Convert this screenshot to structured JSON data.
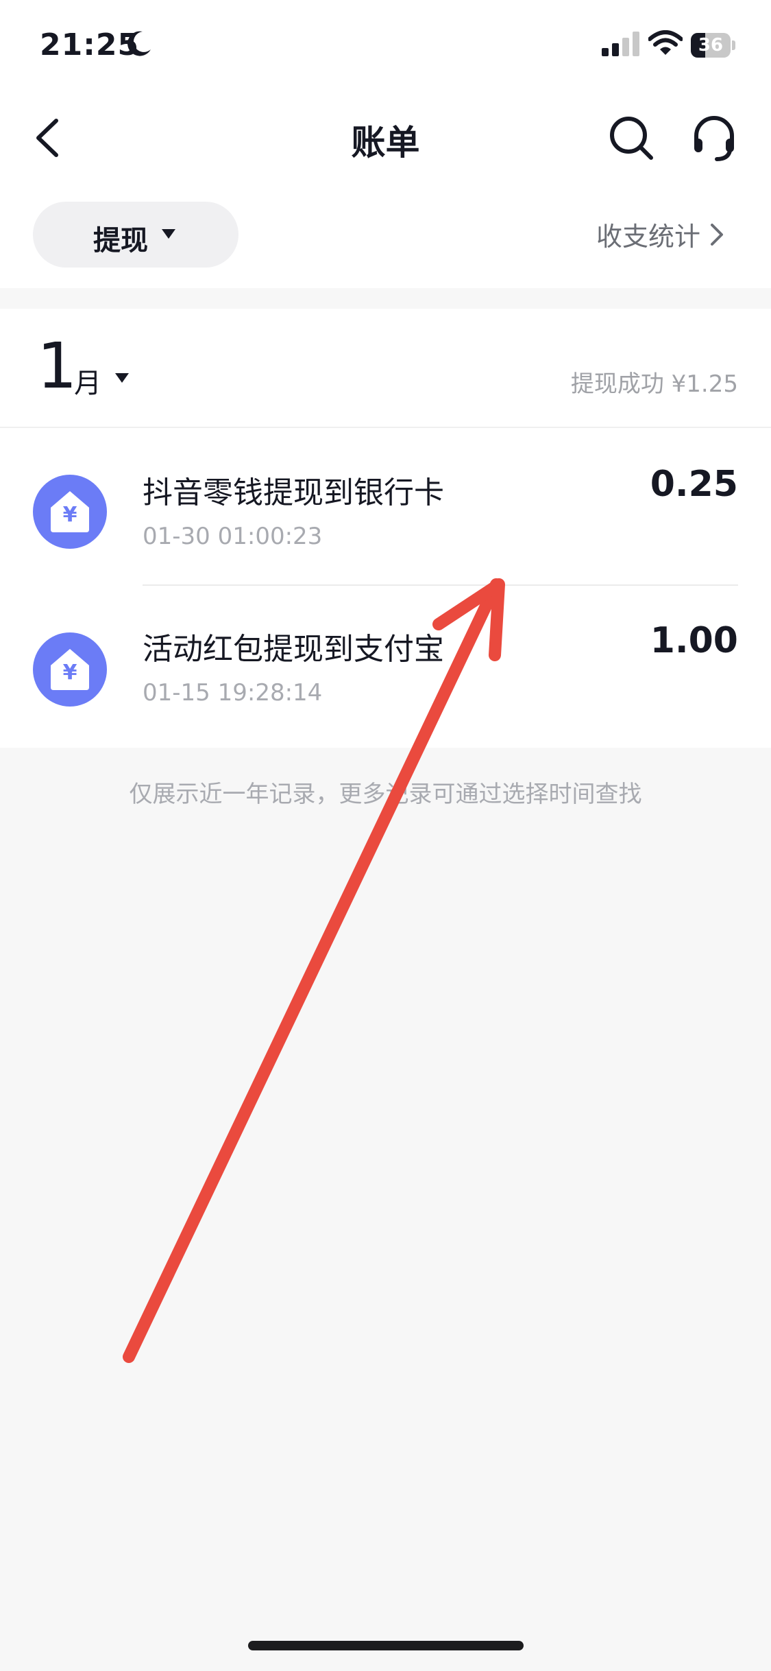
{
  "status_bar": {
    "time": "21:25",
    "battery": "36",
    "battery_level": 0.36,
    "icons": [
      "moon-icon",
      "signal-icon",
      "wifi-icon",
      "battery-icon"
    ]
  },
  "nav": {
    "title": "账单",
    "icons": [
      "back-icon",
      "search-icon",
      "customer-service-icon"
    ]
  },
  "filter": {
    "label": "提现",
    "stats_label": "收支统计"
  },
  "month": {
    "number": "1",
    "unit": "月",
    "summary": "提现成功 ¥1.25"
  },
  "transactions": [
    {
      "title": "抖音零钱提现到银行卡",
      "time": "01-30 01:00:23",
      "amount": "0.25",
      "icon": "withdraw-house-yen-icon"
    },
    {
      "title": "活动红包提现到支付宝",
      "time": "01-15 19:28:14",
      "amount": "1.00",
      "icon": "withdraw-house-yen-icon"
    }
  ],
  "footer_note": "仅展示近一年记录，更多记录可通过选择时间查找",
  "colors": {
    "accent_icon": "#6b7cf6",
    "annotation_arrow": "#ea4a3e",
    "text_primary": "#161823",
    "text_secondary": "#a8aab0",
    "background": "#f7f7f7"
  }
}
